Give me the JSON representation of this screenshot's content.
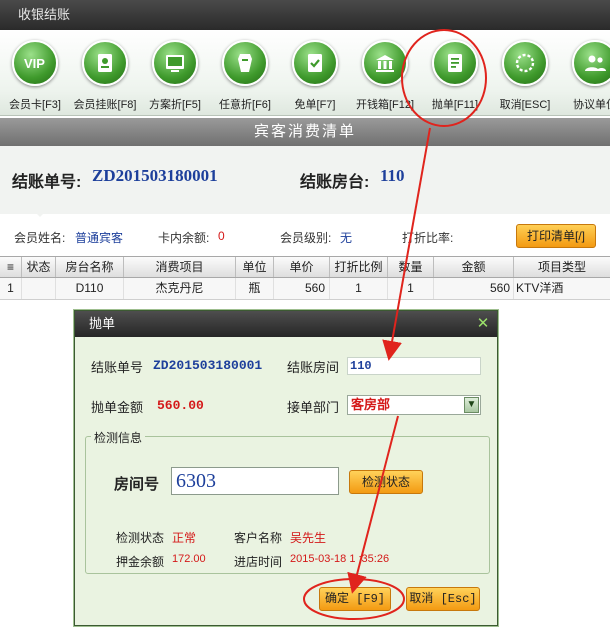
{
  "window": {
    "title": "收银结账"
  },
  "toolbar": [
    {
      "label": "会员卡[F3]",
      "icon": "vip-card-icon"
    },
    {
      "label": "会员挂账[F8]",
      "icon": "member-account-icon"
    },
    {
      "label": "方案折[F5]",
      "icon": "plan-discount-icon"
    },
    {
      "label": "任意折[F6]",
      "icon": "custom-discount-icon"
    },
    {
      "label": "免单[F7]",
      "icon": "free-bill-icon"
    },
    {
      "label": "开钱箱[F12]",
      "icon": "cash-drawer-icon"
    },
    {
      "label": "抛单[F11]",
      "icon": "transfer-bill-icon"
    },
    {
      "label": "取消[ESC]",
      "icon": "cancel-icon"
    },
    {
      "label": "协议单位",
      "icon": "contract-unit-icon"
    }
  ],
  "bill": {
    "title": "宾客消费清单",
    "no_label": "结账单号:",
    "no_value": "ZD201503180001",
    "room_label": "结账房台:",
    "room_value": "110"
  },
  "member": {
    "name_label": "会员姓名:",
    "name_value": "普通宾客",
    "balance_label": "卡内余额:",
    "balance_value": "0",
    "level_label": "会员级别:",
    "level_value": "无",
    "discount_label": "打折比率:",
    "print_button": "打印清单[/]"
  },
  "table": {
    "headers": [
      "状态",
      "房台名称",
      "消费项目",
      "单位",
      "单价",
      "打折比例",
      "数量",
      "金额",
      "项目类型"
    ],
    "rows": [
      {
        "index": "1",
        "status": "",
        "room": "D110",
        "item": "杰克丹尼",
        "unit": "瓶",
        "price": "560",
        "discount": "1",
        "qty": "1",
        "amount": "560",
        "type": "KTV洋酒"
      }
    ]
  },
  "dialog": {
    "title": "抛单",
    "bill_no_label": "结账单号",
    "bill_no_value": "ZD201503180001",
    "room_label": "结账房间",
    "room_value": "110",
    "amount_label": "抛单金额",
    "amount_value": "560.00",
    "dept_label": "接单部门",
    "dept_value": "客房部",
    "check_group_label": "检测信息",
    "room_no_label": "房间号",
    "room_no_value": "6303",
    "check_button": "检测状态",
    "status_label": "检测状态",
    "status_value": "正常",
    "customer_label": "客户名称",
    "customer_value": "吴先生",
    "deposit_label": "押金余额",
    "deposit_value": "172.00",
    "checkin_label": "进店时间",
    "checkin_value": "2015-03-18 1 :35:26",
    "confirm_button": "确定 [F9]",
    "cancel_button": "取消 [Esc]"
  },
  "colors": {
    "annotation": "#e0241d",
    "brand_green": "#3f9a2c",
    "value_blue": "#1d3f9b",
    "value_red": "#d41919"
  }
}
